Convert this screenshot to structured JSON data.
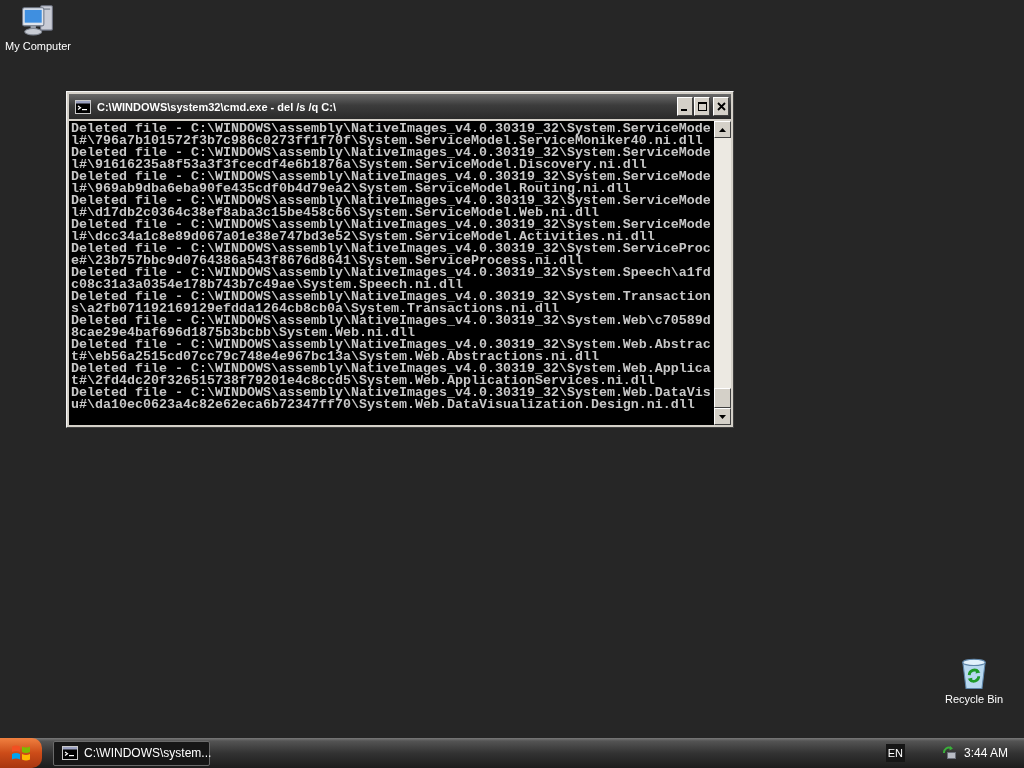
{
  "desktop_icons": [
    {
      "label": "My Computer",
      "kind": "computer"
    },
    {
      "label": "Recycle Bin",
      "kind": "recycle-bin"
    }
  ],
  "window": {
    "title": "C:\\WINDOWS\\system32\\cmd.exe - del /s /q C:\\",
    "console_lines": [
      "Deleted file - C:\\WINDOWS\\assembly\\NativeImages_v4.0.30319_32\\System.ServiceMode",
      "l#\\796a7b101572f3b7c986c0273ff1f70f\\System.ServiceModel.ServiceMoniker40.ni.dll",
      "Deleted file - C:\\WINDOWS\\assembly\\NativeImages_v4.0.30319_32\\System.ServiceMode",
      "l#\\91616235a8f53a3f3fcecdf4e6b1876a\\System.ServiceModel.Discovery.ni.dll",
      "Deleted file - C:\\WINDOWS\\assembly\\NativeImages_v4.0.30319_32\\System.ServiceMode",
      "l#\\969ab9dba6eba90fe435cdf0b4d79ea2\\System.ServiceModel.Routing.ni.dll",
      "Deleted file - C:\\WINDOWS\\assembly\\NativeImages_v4.0.30319_32\\System.ServiceMode",
      "l#\\d17db2c0364c38ef8aba3c15be458c66\\System.ServiceModel.Web.ni.dll",
      "Deleted file - C:\\WINDOWS\\assembly\\NativeImages_v4.0.30319_32\\System.ServiceMode",
      "l#\\dcc34a1c8e89d067a01e38e747bd3e52\\System.ServiceModel.Activities.ni.dll",
      "Deleted file - C:\\WINDOWS\\assembly\\NativeImages_v4.0.30319_32\\System.ServiceProc",
      "e#\\23b757bbc9d0764386a543f8676d8641\\System.ServiceProcess.ni.dll",
      "Deleted file - C:\\WINDOWS\\assembly\\NativeImages_v4.0.30319_32\\System.Speech\\a1fd",
      "c08c31a3a0354e178b743b7c49ae\\System.Speech.ni.dll",
      "Deleted file - C:\\WINDOWS\\assembly\\NativeImages_v4.0.30319_32\\System.Transaction",
      "s\\a2fb071192169129efdda1264cb8cb0a\\System.Transactions.ni.dll",
      "Deleted file - C:\\WINDOWS\\assembly\\NativeImages_v4.0.30319_32\\System.Web\\c70589d",
      "8cae29e4baf696d1875b3bcbb\\System.Web.ni.dll",
      "Deleted file - C:\\WINDOWS\\assembly\\NativeImages_v4.0.30319_32\\System.Web.Abstrac",
      "t#\\eb56a2515cd07cc79c748e4e967bc13a\\System.Web.Abstractions.ni.dll",
      "Deleted file - C:\\WINDOWS\\assembly\\NativeImages_v4.0.30319_32\\System.Web.Applica",
      "t#\\2fd4dc20f326515738f79201e4c8ccd5\\System.Web.ApplicationServices.ni.dll",
      "Deleted file - C:\\WINDOWS\\assembly\\NativeImages_v4.0.30319_32\\System.Web.DataVis",
      "u#\\da10ec0623a4c82e62eca6b72347ff70\\System.Web.DataVisualization.Design.ni.dll"
    ]
  },
  "taskbar": {
    "tasks": [
      {
        "label": "C:\\WINDOWS\\system...",
        "selected": true
      }
    ],
    "language": "EN",
    "clock": "3:44 AM"
  }
}
